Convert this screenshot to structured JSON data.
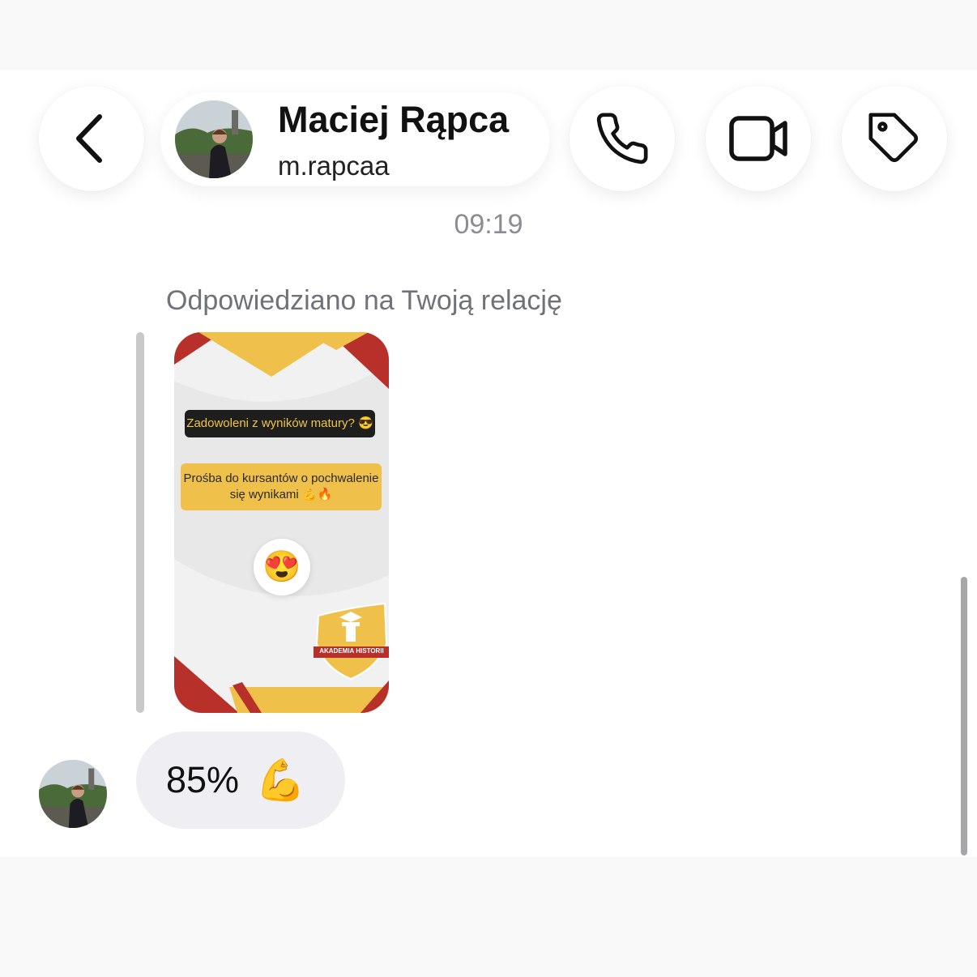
{
  "header": {
    "name": "Maciej Rąpca",
    "username": "m.rapcaa",
    "back_icon": "chevron-left-icon",
    "actions": [
      {
        "name": "call",
        "icon": "phone-icon"
      },
      {
        "name": "video",
        "icon": "video-camera-icon"
      },
      {
        "name": "tag",
        "icon": "tag-icon"
      }
    ]
  },
  "conversation": {
    "timestamp": "09:19",
    "reply_label": "Odpowiedziano na Twoją relację",
    "story": {
      "question": "Zadowoleni z wyników matury? 😎",
      "request": "Prośba do kursantów o pochwalenie się wynikami 💪🔥",
      "reaction": "😍",
      "logo_text": "AKADEMIA HISTORII"
    },
    "message": {
      "text": "85%",
      "emoji": "💪"
    }
  },
  "colors": {
    "accent_red": "#b8302a",
    "accent_gold": "#efc04a",
    "bubble_bg": "#efeff3"
  }
}
